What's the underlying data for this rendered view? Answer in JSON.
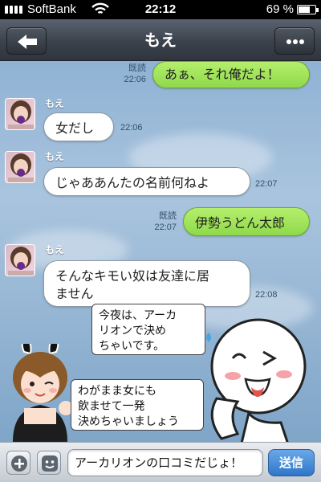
{
  "status_bar": {
    "carrier": "SoftBank",
    "time": "22:12",
    "battery_percent": "69 %",
    "battery_level": 0.69,
    "icons": [
      "signal-icon",
      "wifi-icon",
      "battery-icon"
    ]
  },
  "header": {
    "title": "もえ",
    "back_icon": "arrow-left-icon",
    "menu_icon": "more-dots-icon"
  },
  "messages": [
    {
      "side": "right",
      "text": "あぁ、それ俺だよ！",
      "read": "既読",
      "time": "22:06"
    },
    {
      "side": "left",
      "sender": "もえ",
      "text": "女だし",
      "time": "22:06"
    },
    {
      "side": "left",
      "sender": "もえ",
      "text": "じゃああんたの名前何ねよ",
      "time": "22:07"
    },
    {
      "side": "right",
      "text": "伊勢うどん太郎",
      "read": "既読",
      "time": "22:07"
    },
    {
      "side": "left",
      "sender": "もえ",
      "text_line1": "そんなキモい奴は友達に居",
      "text_line2": "ません",
      "time": "22:08"
    }
  ],
  "stickers": {
    "bubble1_lines": [
      "今夜は、アーカ",
      "リオンで決め",
      "ちゃいです。"
    ],
    "bubble2_lines": [
      "わがまま女にも",
      "飲ませて一発",
      "決めちゃいましょう"
    ]
  },
  "input_bar": {
    "plus_icon": "plus-icon",
    "emoji_icon": "emoji-icon",
    "text_value": "アーカリオンの口コミだじょ！",
    "send_label": "送信"
  },
  "colors": {
    "green_bubble": "#9be05a",
    "send_button": "#3f86d6",
    "header": "#3b424c"
  }
}
